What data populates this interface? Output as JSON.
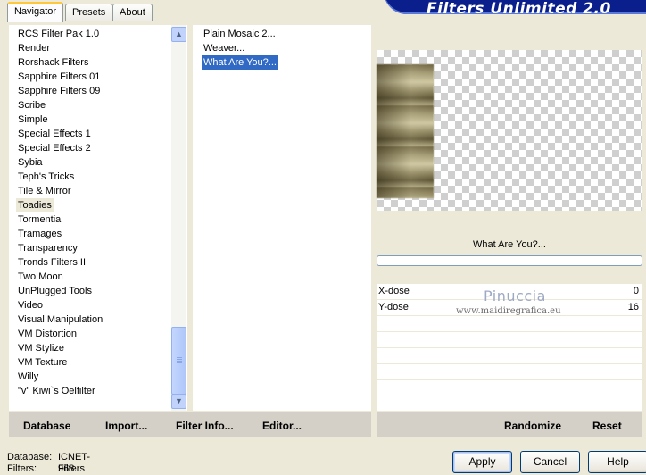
{
  "tabs": [
    "Navigator",
    "Presets",
    "About"
  ],
  "banner_title": "Filters Unlimited 2.0",
  "categories": [
    "RCS Filter Pak 1.0",
    "Render",
    "Rorshack Filters",
    "Sapphire Filters 01",
    "Sapphire Filters 09",
    "Scribe",
    "Simple",
    "Special Effects 1",
    "Special Effects 2",
    "Sybia",
    "Teph's Tricks",
    "Tile & Mirror",
    "Toadies",
    "Tormentia",
    "Tramages",
    "Transparency",
    "Tronds Filters II",
    "Two Moon",
    "UnPlugged Tools",
    "Video",
    "Visual Manipulation",
    "VM Distortion",
    "VM Stylize",
    "VM Texture",
    "Willy",
    "\"v\" Kiwi`s Oelfilter"
  ],
  "selected_category": "Toadies",
  "filters": [
    "Plain Mosaic 2...",
    "Weaver...",
    "What Are You?..."
  ],
  "selected_filter": "What Are You?...",
  "current_filter_name": "What Are You?...",
  "params": [
    {
      "label": "X-dose",
      "value": "0"
    },
    {
      "label": "Y-dose",
      "value": "16"
    }
  ],
  "watermark": {
    "name": "Pinuccia",
    "url": "www.maidiregrafica.eu"
  },
  "left_buttons": {
    "database": "Database",
    "import": "Import...",
    "filter_info": "Filter Info...",
    "editor": "Editor..."
  },
  "right_buttons": {
    "randomize": "Randomize",
    "reset": "Reset"
  },
  "status": {
    "database_label": "Database:",
    "database_value": "ICNET-Filters",
    "filters_label": "Filters:",
    "filters_value": "968"
  },
  "dialog_buttons": {
    "apply": "Apply",
    "cancel": "Cancel",
    "help": "Help"
  },
  "scrollbar": {
    "up_icon": "▲",
    "down_icon": "▼"
  }
}
